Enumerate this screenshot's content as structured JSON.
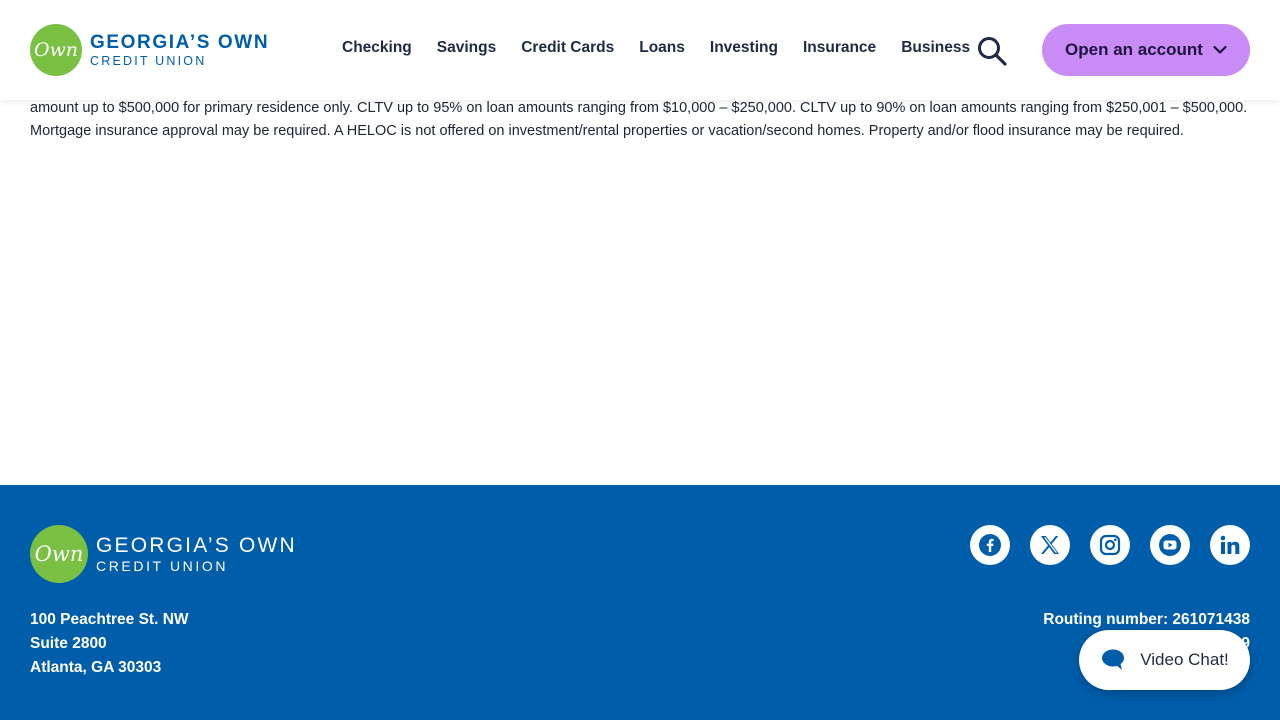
{
  "header": {
    "logo": {
      "mark": "Own",
      "name": "GEORGIA’S OWN",
      "sub": "CREDIT UNION"
    },
    "nav": [
      "Checking",
      "Savings",
      "Credit Cards",
      "Loans",
      "Investing",
      "Insurance",
      "Business"
    ],
    "search_icon": "search-icon",
    "cta_label": "Open an account",
    "cta_color": "#c98bf5"
  },
  "content": {
    "disclosure": "amount up to $500,000 for primary residence only. CLTV up to 95% on loan amounts ranging from $10,000 – $250,000. CLTV up to 90% on loan amounts ranging from $250,001 – $500,000. Mortgage insurance approval may be required. A HELOC is not offered on investment/rental properties or vacation/second homes. Property and/or flood insurance may be required."
  },
  "footer": {
    "logo": {
      "mark": "Own",
      "name": "GEORGIA’S OWN",
      "sub": "CREDIT UNION"
    },
    "address": [
      "100 Peachtree St. NW",
      "Suite 2800",
      "Atlanta, GA 30303"
    ],
    "routing": "Routing number: 261071438",
    "routing_partial": "9",
    "socials": [
      "facebook-icon",
      "x-icon",
      "instagram-icon",
      "youtube-icon",
      "linkedin-icon"
    ],
    "background": "#005daa"
  },
  "chat": {
    "label": "Video Chat!"
  },
  "colors": {
    "brand_blue": "#005daa",
    "brand_green": "#7ac143",
    "nav_text": "#1f2a44"
  }
}
